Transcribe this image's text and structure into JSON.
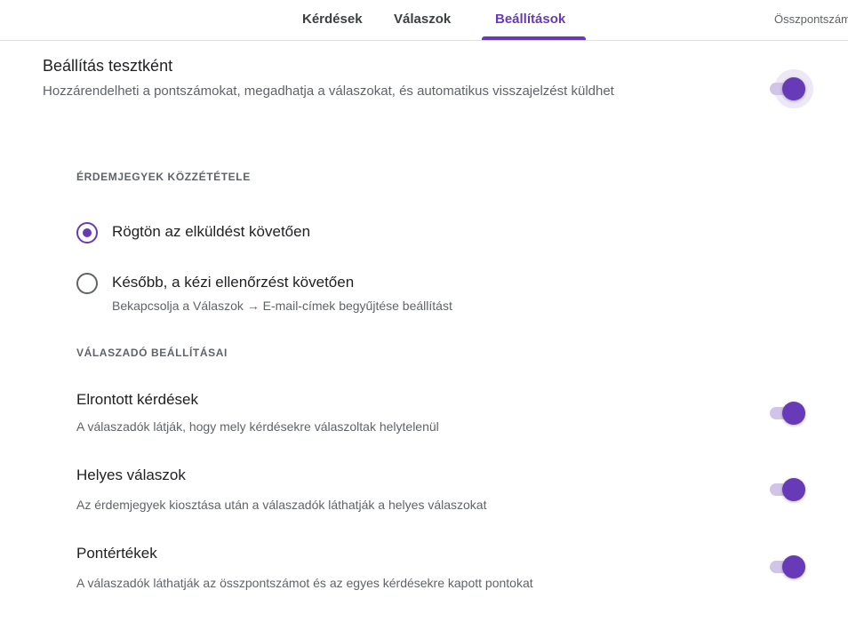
{
  "tabs": {
    "items": [
      {
        "label": "Kérdések",
        "active": false
      },
      {
        "label": "Válaszok",
        "active": false
      },
      {
        "label": "Beállítások",
        "active": true
      }
    ],
    "points_label": "Összpontszám"
  },
  "quiz": {
    "title": "Beállítás tesztként",
    "description": "Hozzárendelheti a pontszámokat, megadhatja a válaszokat, és automatikus visszajelzést küldhet",
    "enabled": true
  },
  "release_grades": {
    "heading": "ÉRDEMJEGYEK KÖZZÉTÉTELE",
    "options": [
      {
        "label": "Rögtön az elküldést követően",
        "checked": true,
        "sublabel": ""
      },
      {
        "label": "Később, a kézi ellenőrzést követően",
        "checked": false,
        "sublabel": "Bekapcsolja a Válaszok → E-mail-címek begyűjtése beállítást"
      }
    ]
  },
  "respondent": {
    "heading": "VÁLASZADÓ BEÁLLÍTÁSAI",
    "settings": [
      {
        "title": "Elrontott kérdések",
        "description": "A válaszadók látják, hogy mely kérdésekre válaszoltak helytelenül",
        "enabled": true
      },
      {
        "title": "Helyes válaszok",
        "description": "Az érdemjegyek kiosztása után a válaszadók láthatják a helyes válaszokat",
        "enabled": true
      },
      {
        "title": "Pontértékek",
        "description": "A válaszadók láthatják az összpontszámot és az egyes kérdésekre kapott pontokat",
        "enabled": true
      }
    ]
  },
  "colors": {
    "accent": "#673ab7",
    "track": "#d1c4e9",
    "text_secondary": "#5f6368"
  }
}
